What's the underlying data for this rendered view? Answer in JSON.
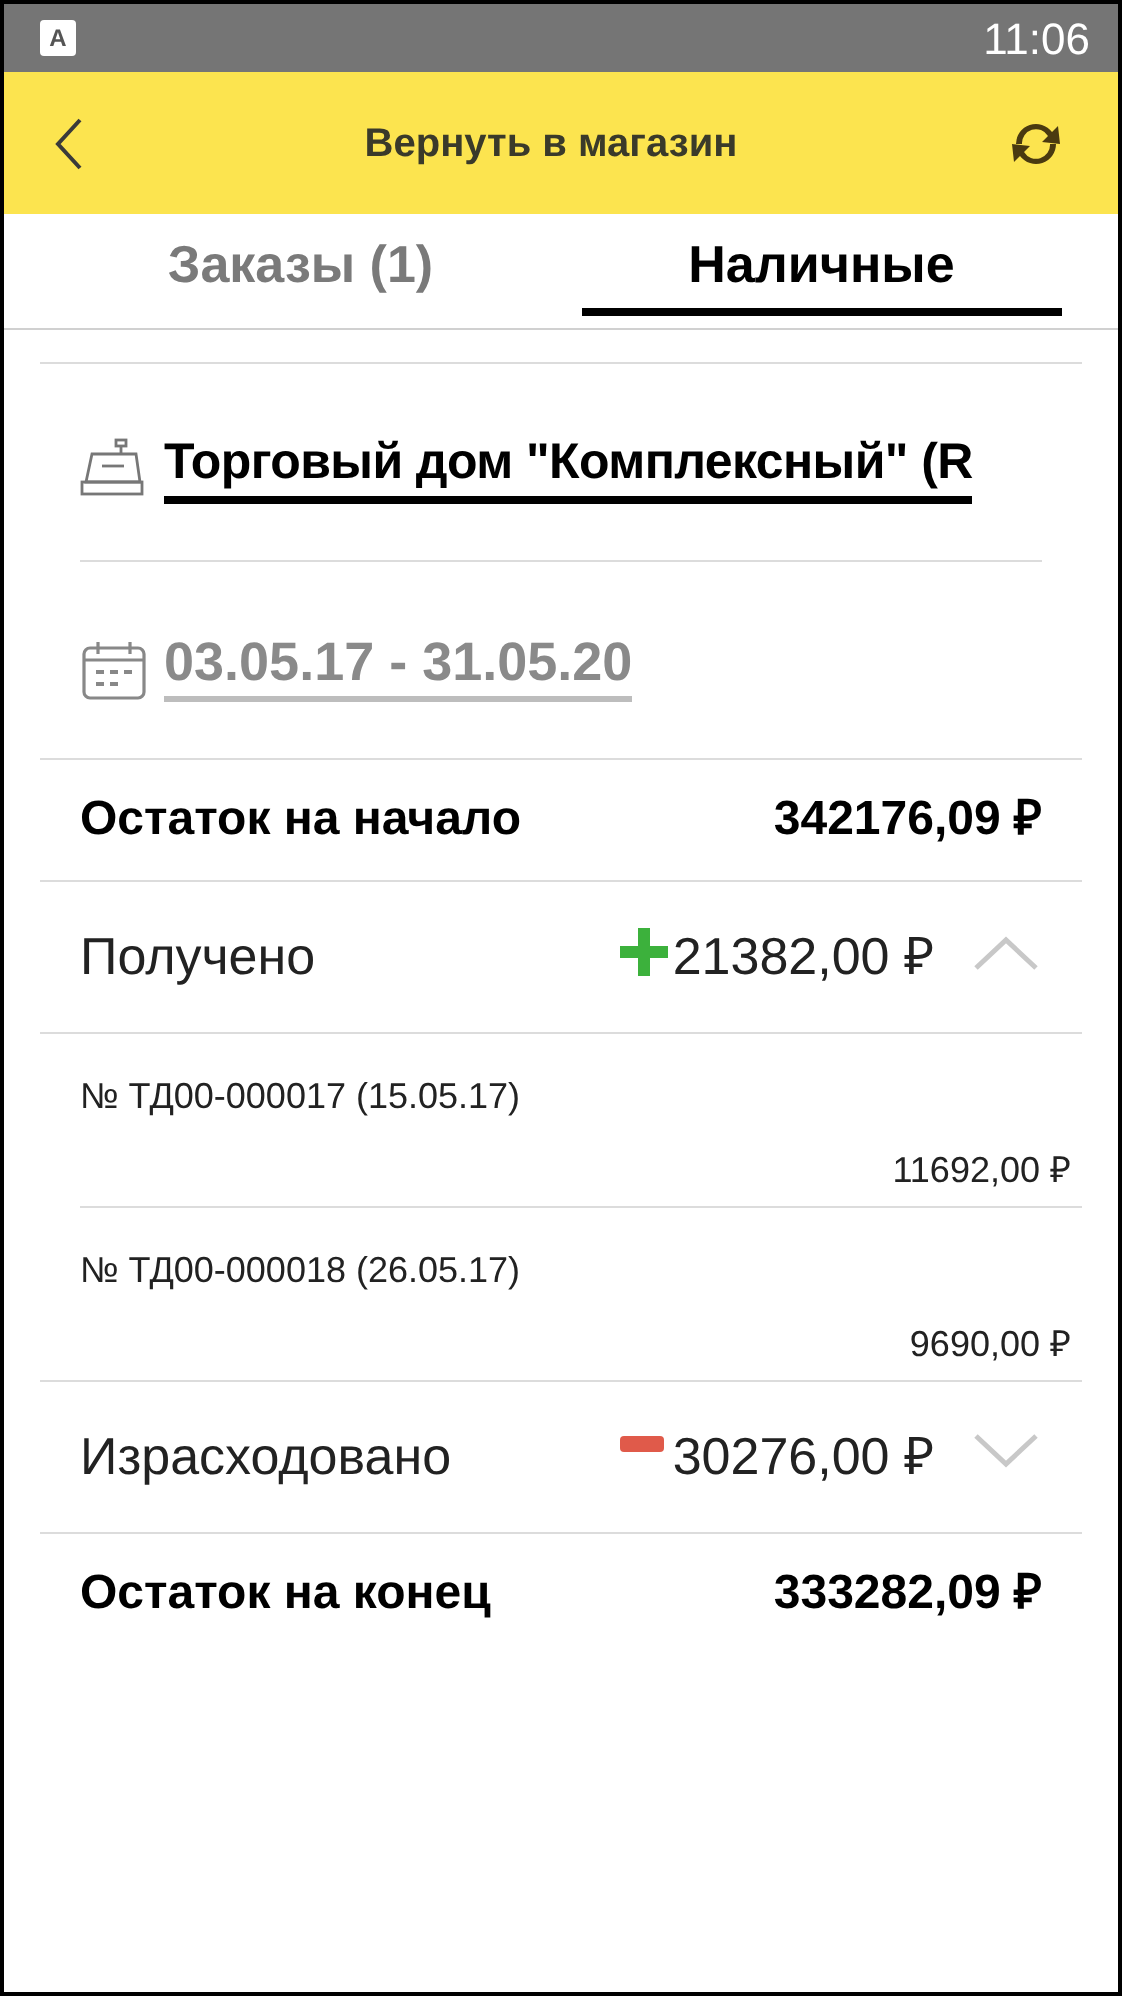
{
  "status_bar": {
    "app_icon_letter": "A",
    "time": "11:06"
  },
  "header": {
    "title": "Вернуть в магазин"
  },
  "tabs": [
    {
      "label": "Заказы (1)",
      "selected": false
    },
    {
      "label": "Наличные",
      "selected": true
    }
  ],
  "store": {
    "name": "Торговый дом \"Комплексный\" (R"
  },
  "period": {
    "value": "03.05.17 - 31.05.20"
  },
  "rows": [
    {
      "kind": "balance",
      "label": "Остаток на начало",
      "amount": "342176,09 ₽"
    },
    {
      "kind": "income",
      "label": "Получено",
      "amount": "21382,00 ₽",
      "expanded": true,
      "items": [
        {
          "number": "№ ТД00-000017 (15.05.17)",
          "amount": "11692,00 ₽"
        },
        {
          "number": "№ ТД00-000018 (26.05.17)",
          "amount": "9690,00 ₽"
        }
      ]
    },
    {
      "kind": "expense",
      "label": "Израсходовано",
      "amount": "30276,00 ₽",
      "expanded": false
    },
    {
      "kind": "balance",
      "label": "Остаток на конец",
      "amount": "333282,09 ₽"
    }
  ]
}
